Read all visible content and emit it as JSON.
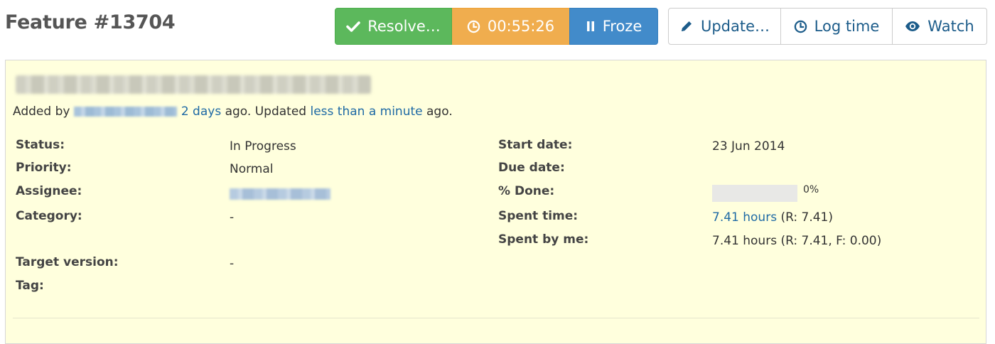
{
  "title": "Feature #13704",
  "toolbar": {
    "resolve_label": "Resolve…",
    "timer_label": "00:55:26",
    "froze_label": "Froze",
    "update_label": "Update…",
    "logtime_label": "Log time",
    "watch_label": "Watch"
  },
  "meta": {
    "added_by_prefix": "Added by",
    "added_ago": "2 days",
    "ago_updated": "ago. Updated",
    "updated_ago": "less than a minute",
    "ago_end": "ago."
  },
  "attributes": {
    "status_label": "Status:",
    "status_value": "In Progress",
    "priority_label": "Priority:",
    "priority_value": "Normal",
    "assignee_label": "Assignee:",
    "category_label": "Category:",
    "category_value": "-",
    "target_label": "Target version:",
    "target_value": "-",
    "tag_label": "Tag:",
    "start_label": "Start date:",
    "start_value": "23 Jun 2014",
    "due_label": "Due date:",
    "done_label": "% Done:",
    "done_value": 0,
    "done_text": "0%",
    "spent_label": "Spent time:",
    "spent_link": "7.41 hours",
    "spent_extra": "(R: 7.41)",
    "spentme_label": "Spent by me:",
    "spentme_value": "7.41 hours (R: 7.41, F: 0.00)"
  },
  "colors": {
    "resolve": "#5cb85c",
    "timer": "#f0ad4e",
    "froze": "#428bca",
    "issue_bg": "#ffffdd",
    "link": "#1f6aa5"
  },
  "icons": {
    "resolve": "check-icon",
    "timer": "clock-icon",
    "froze": "pause-icon",
    "update": "pencil-icon",
    "logtime": "clock-icon",
    "watch": "eye-icon"
  }
}
